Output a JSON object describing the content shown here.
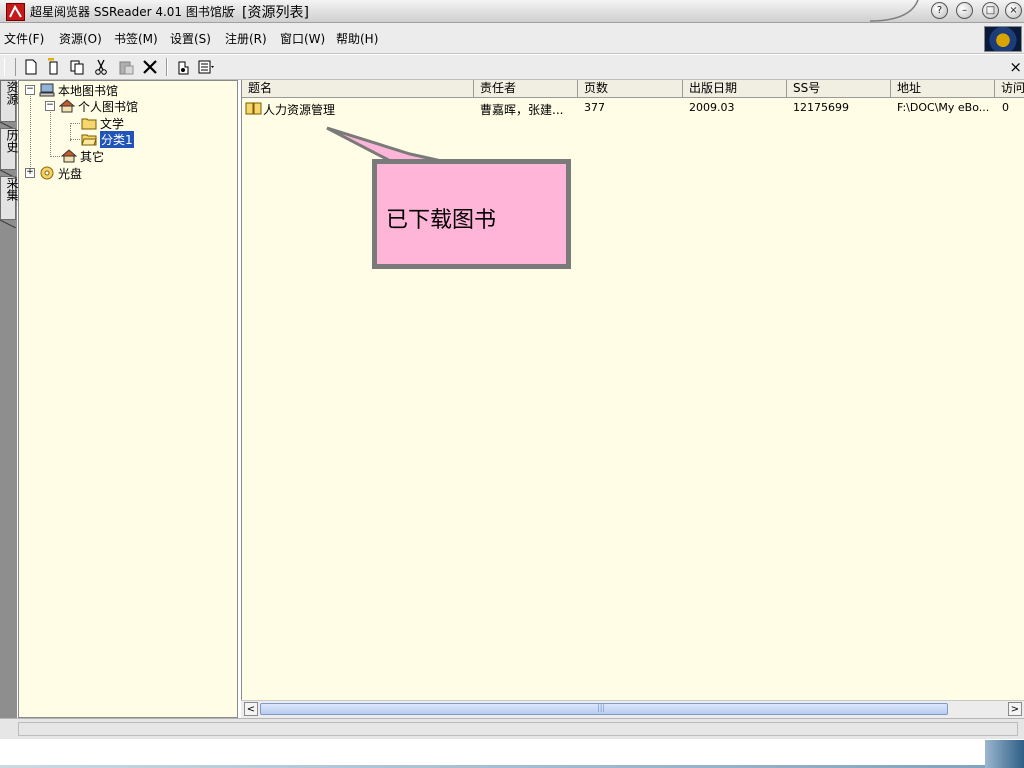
{
  "window": {
    "app_title": "超星阅览器 SSReader 4.01 图书馆版",
    "title_separator": "–",
    "document_title": "[资源列表]",
    "buttons": {
      "help": "?",
      "minimize": "–",
      "maximize": "□",
      "close": "×"
    }
  },
  "menu": {
    "items": [
      "文件(F)",
      "资源(O)",
      "书签(M)",
      "设置(S)",
      "注册(R)",
      "窗口(W)",
      "帮助(H)"
    ]
  },
  "toolbar": {
    "close_label": "×",
    "icons": [
      "new-icon",
      "new-folder-icon",
      "copy-icon",
      "cut-icon",
      "paste-icon",
      "delete-icon",
      "properties-icon",
      "view-options-icon"
    ]
  },
  "side_tabs": [
    "资源",
    "历史",
    "采集"
  ],
  "tree": {
    "root": "本地图书馆",
    "personal": "个人图书馆",
    "literature": "文学",
    "category1": "分类1",
    "others": "其它",
    "disc": "光盘",
    "collapse_glyph": "−",
    "expand_glyph": "+"
  },
  "list": {
    "columns": [
      "题名",
      "责任者",
      "页数",
      "出版日期",
      "SS号",
      "地址",
      "访问"
    ],
    "rows": [
      {
        "title": "人力资源管理",
        "author": "曹嘉晖，张建...",
        "pages": "377",
        "date": "2009.03",
        "ss": "12175699",
        "path": "F:\\DOC\\My eBo...",
        "visits": "0"
      }
    ]
  },
  "scrollbar": {
    "left_arrow": "<",
    "right_arrow": ">",
    "grip": "|||"
  },
  "callout": {
    "text": "已下载图书",
    "fill": "#ffb5d8",
    "border": "#7a7a7a"
  },
  "colors": {
    "pane_background": "#fffde5",
    "selection": "#2154b9"
  }
}
